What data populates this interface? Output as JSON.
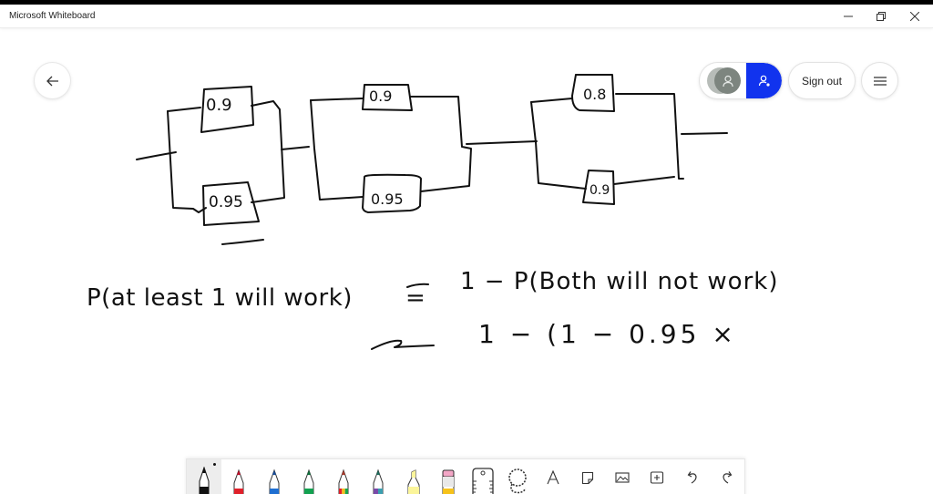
{
  "window": {
    "title": "Microsoft Whiteboard",
    "controls": {
      "minimize_icon": "minimize-icon",
      "maximize_icon": "restore-icon",
      "close_icon": "close-icon"
    }
  },
  "header": {
    "back_icon": "arrow-left-icon",
    "user_icon": "person-icon",
    "invite_icon": "person-add-icon",
    "invite_color": "#1133ee",
    "sign_out_label": "Sign out",
    "menu_icon": "hamburger-menu-icon"
  },
  "canvas": {
    "circuit_blocks": [
      {
        "label": "block-1",
        "top_component": "0.9",
        "bottom_component": "0.95"
      },
      {
        "label": "block-2",
        "top_component": "0.9",
        "bottom_component": "0.95"
      },
      {
        "label": "block-3",
        "top_component": "0.8",
        "bottom_component": "0.9"
      }
    ],
    "equation_line_1_left": "P(at least 1 will work)",
    "equation_line_1_eq": "=",
    "equation_line_1_right": "1 − P(Both will not work)",
    "equation_line_2_eq": "=",
    "equation_line_2_right": "1 − (1 − 0.95 ×"
  },
  "toolbar": {
    "tools": [
      {
        "name": "pen-black",
        "color": "#111111",
        "selected": true
      },
      {
        "name": "pen-red",
        "color": "#e0202a",
        "selected": false
      },
      {
        "name": "pen-blue",
        "color": "#1f6fd1",
        "selected": false
      },
      {
        "name": "pen-green",
        "color": "#12a150",
        "selected": false
      },
      {
        "name": "pen-rainbow",
        "color": "#e05a1a",
        "selected": false
      },
      {
        "name": "pen-galaxy",
        "color": "#6e5aa8",
        "selected": false
      },
      {
        "name": "highlighter",
        "color": "#fbf59a",
        "selected": false
      },
      {
        "name": "eraser",
        "color": "#f3a6c6",
        "selected": false
      },
      {
        "name": "ruler",
        "color": "#333333",
        "selected": false
      },
      {
        "name": "lasso",
        "color": "#333333",
        "selected": false
      },
      {
        "name": "text",
        "color": "#333333",
        "selected": false
      },
      {
        "name": "sticky-note",
        "color": "#333333",
        "selected": false
      },
      {
        "name": "image",
        "color": "#333333",
        "selected": false
      },
      {
        "name": "insert",
        "color": "#333333",
        "selected": false
      },
      {
        "name": "undo",
        "color": "#333333",
        "selected": false
      },
      {
        "name": "redo",
        "color": "#333333",
        "selected": false
      }
    ]
  }
}
